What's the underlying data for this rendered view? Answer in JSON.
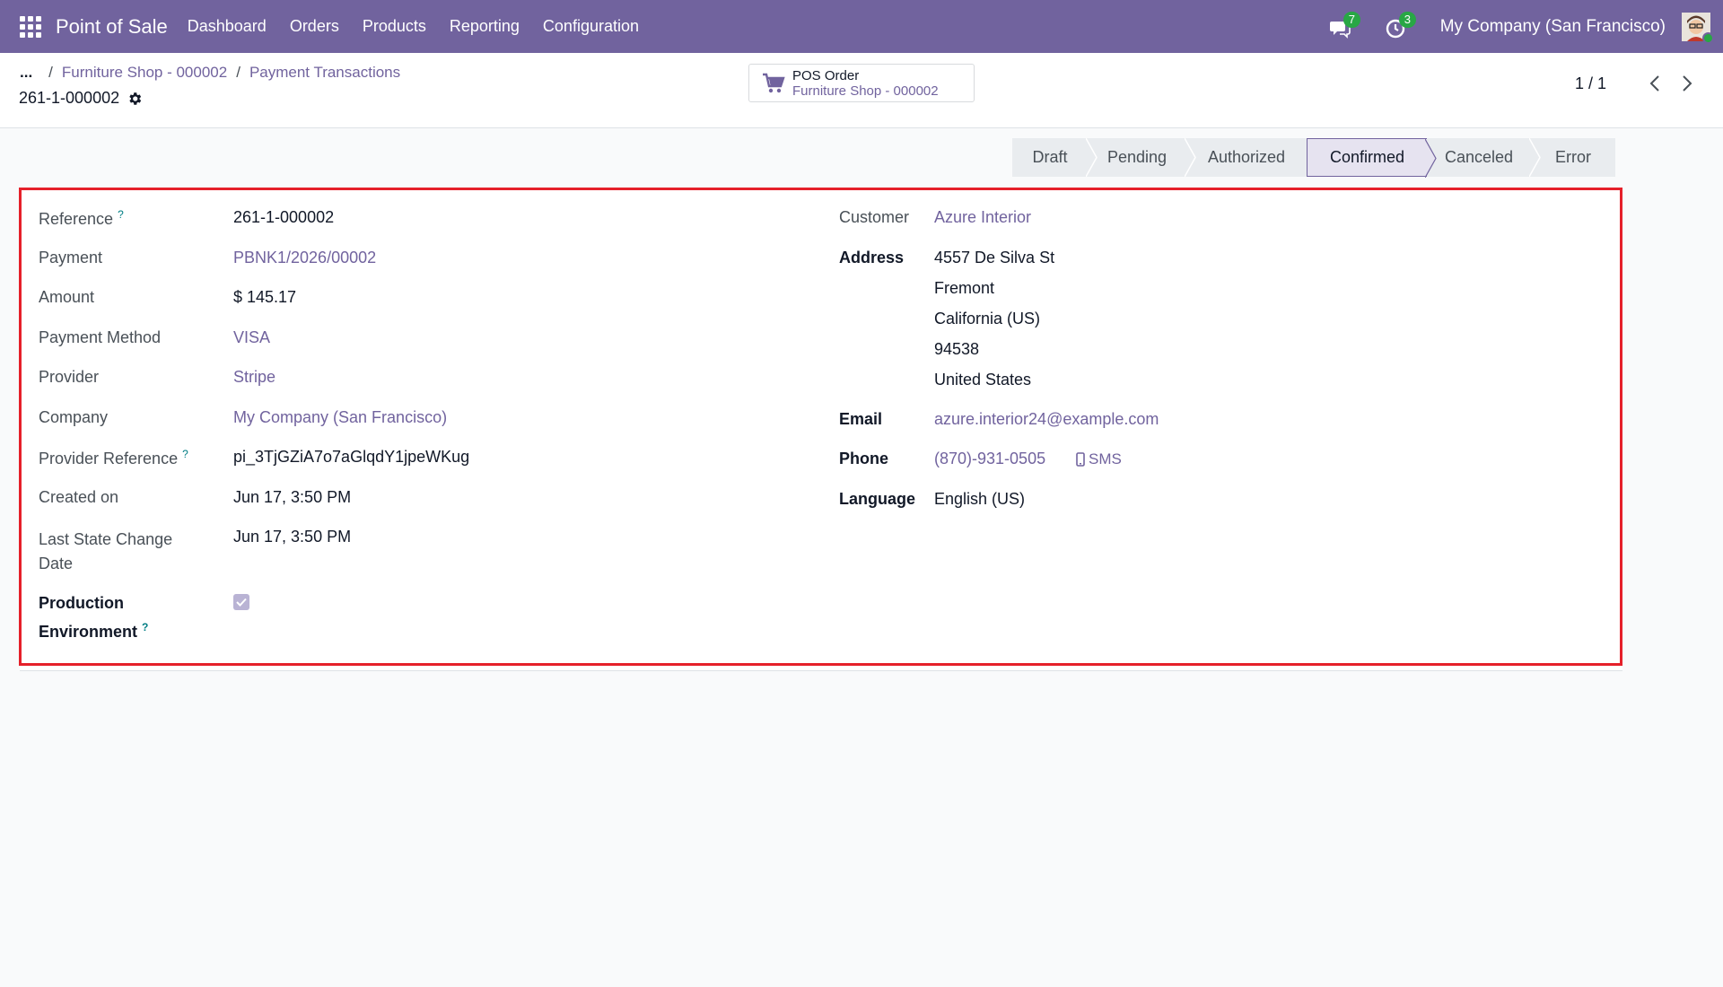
{
  "navbar": {
    "app_name": "Point of Sale",
    "menu": [
      "Dashboard",
      "Orders",
      "Products",
      "Reporting",
      "Configuration"
    ],
    "messages_count": "7",
    "activities_count": "3",
    "company": "My Company (San Francisco)"
  },
  "breadcrumb": {
    "dots": "...",
    "items": [
      "Furniture Shop - 000002",
      "Payment Transactions"
    ],
    "record_title": "261-1-000002"
  },
  "smart_button": {
    "title": "POS Order",
    "value": "Furniture Shop - 000002"
  },
  "pager": {
    "value": "1 / 1"
  },
  "statusbar": {
    "stages": [
      "Draft",
      "Pending",
      "Authorized",
      "Confirmed",
      "Canceled",
      "Error"
    ],
    "current": "Confirmed"
  },
  "form": {
    "left": {
      "reference": {
        "label": "Reference",
        "value": "261-1-000002"
      },
      "payment": {
        "label": "Payment",
        "value": "PBNK1/2026/00002"
      },
      "amount": {
        "label": "Amount",
        "value": "$ 145.17"
      },
      "payment_method": {
        "label": "Payment Method",
        "value": "VISA"
      },
      "provider": {
        "label": "Provider",
        "value": "Stripe"
      },
      "company": {
        "label": "Company",
        "value": "My Company (San Francisco)"
      },
      "provider_reference": {
        "label": "Provider Reference",
        "value": "pi_3TjGZiA7o7aGlqdY1jpeWKug"
      },
      "created_on": {
        "label": "Created on",
        "value": "Jun 17, 3:50 PM"
      },
      "last_state_change": {
        "label_line1": "Last State Change",
        "label_line2": "Date",
        "value": "Jun 17, 3:50 PM"
      },
      "production_env": {
        "label_line1": "Production",
        "label_line2": "Environment",
        "checked": true
      }
    },
    "right": {
      "customer": {
        "label": "Customer",
        "value": "Azure Interior"
      },
      "address": {
        "label": "Address",
        "lines": [
          "4557 De Silva St",
          "Fremont",
          "California (US)",
          "94538",
          "United States"
        ]
      },
      "email": {
        "label": "Email",
        "value": "azure.interior24@example.com"
      },
      "phone": {
        "label": "Phone",
        "value": "(870)-931-0505",
        "sms_label": "SMS"
      },
      "language": {
        "label": "Language",
        "value": "English (US)"
      }
    },
    "help_mark": "?"
  },
  "colors": {
    "brand": "#71639e",
    "highlight": "#e5202a",
    "badge": "#28a745"
  }
}
